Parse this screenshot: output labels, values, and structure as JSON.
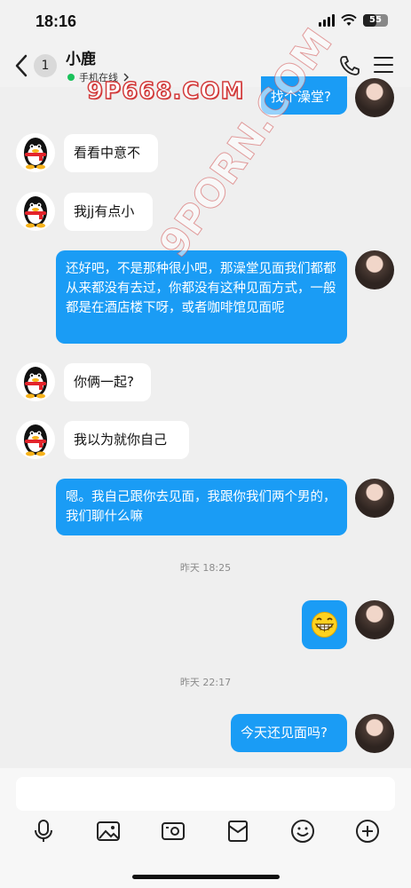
{
  "status_bar": {
    "time": "18:16",
    "battery": "55"
  },
  "header": {
    "unread_count": "1",
    "contact_name": "小鹿",
    "online_status": "手机在线",
    "watermark": "9P668.COM",
    "watermark_diag": "9PORN.COM"
  },
  "messages": {
    "m0": "找个澡堂?",
    "m1": "看看中意不",
    "m2": "我jj有点小",
    "m3": "还好吧，不是那种很小吧，那澡堂见面我们都都从来都没有去过，你都没有这种见面方式，一般都是在酒店楼下呀，或者咖啡馆见面呢",
    "m4": "你俩一起?",
    "m5": "我以为就你自己",
    "m6": "嗯。我自己跟你去见面，我跟你我们两个男的，我们聊什么嘛",
    "time1": "昨天 18:25",
    "m7": "😁",
    "time2": "昨天 22:17",
    "m8": "今天还见面吗?"
  },
  "input": {
    "value": "",
    "placeholder": ""
  },
  "toolbar": {
    "icons": [
      "microphone-icon",
      "image-icon",
      "camera-icon",
      "red-packet-icon",
      "emoji-icon",
      "plus-icon"
    ]
  },
  "colors": {
    "outgoing_bubble": "#1a9cf5",
    "background": "#efefef",
    "online": "#1bc25b"
  }
}
